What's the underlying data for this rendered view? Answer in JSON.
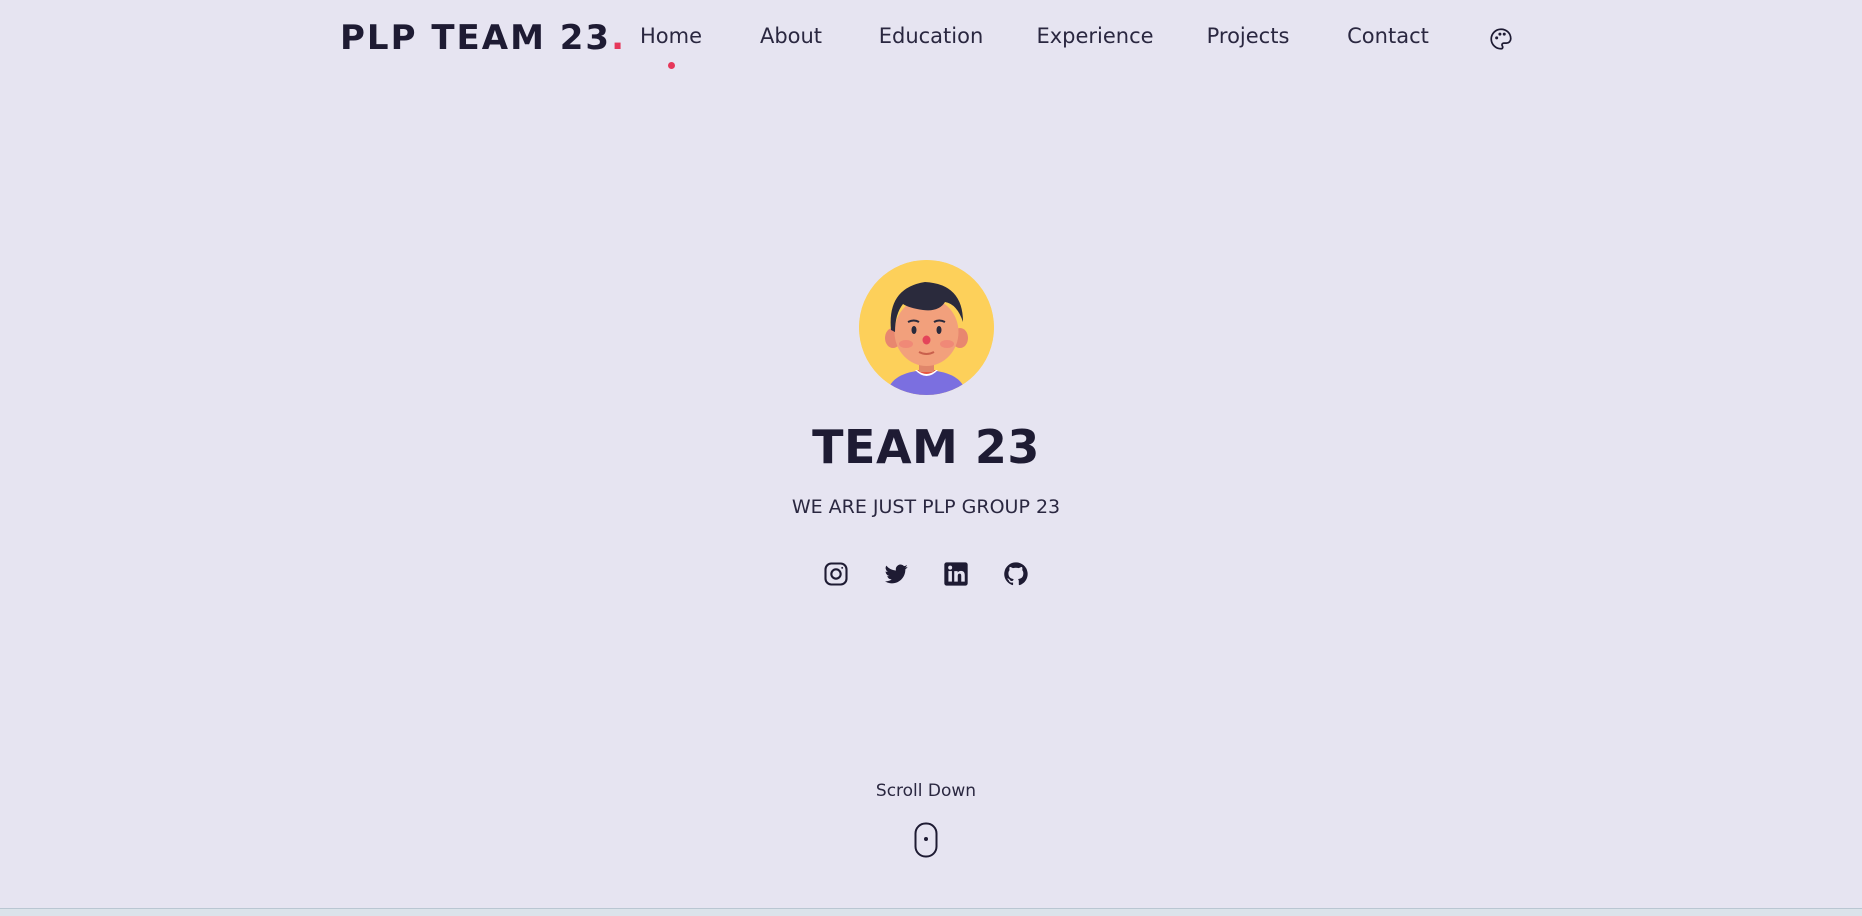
{
  "header": {
    "logo_text": "PLP TEAM 23",
    "logo_dot": ".",
    "nav": [
      {
        "label": "Home",
        "active": true
      },
      {
        "label": "About"
      },
      {
        "label": "Education"
      },
      {
        "label": "Experience"
      },
      {
        "label": "Projects"
      },
      {
        "label": "Contact"
      }
    ],
    "theme_icon": "palette-icon"
  },
  "hero": {
    "title": "TEAM 23",
    "subtitle": "WE ARE JUST PLP GROUP 23",
    "avatar_icon": "avatar-boy-illustration",
    "socials": [
      "instagram-icon",
      "twitter-icon",
      "linkedin-icon",
      "github-icon"
    ]
  },
  "scroll": {
    "label": "Scroll Down",
    "icon": "mouse-icon"
  },
  "colors": {
    "background": "#e6e4f1",
    "text": "#1e1b33",
    "accent": "#e6375a",
    "avatar_bg": "#fdd05a"
  }
}
